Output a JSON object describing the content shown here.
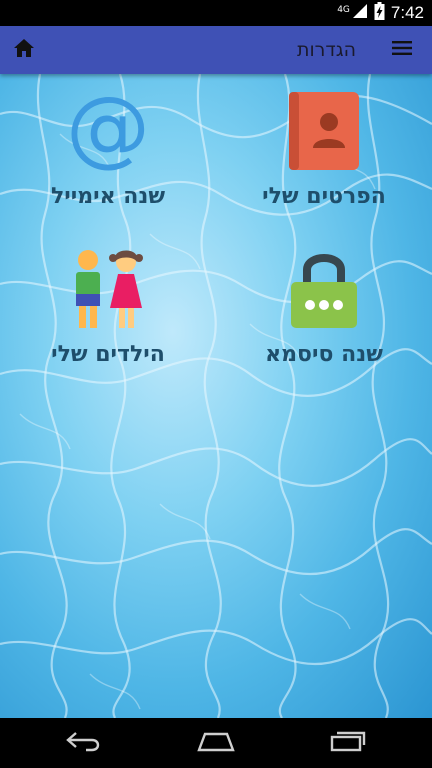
{
  "status_bar": {
    "network": "4G",
    "time": "7:42",
    "icons": [
      "signal-icon",
      "battery-charging-icon"
    ]
  },
  "app_bar": {
    "title": "הגדרות",
    "icons": [
      "home-icon",
      "menu-icon"
    ],
    "color": "#3f51b5"
  },
  "tiles": [
    {
      "id": "my-details",
      "label": "הפרטים שלי",
      "icon": "contacts-book-icon"
    },
    {
      "id": "change-email",
      "label": "שנה אימייל",
      "icon": "at-sign-icon"
    },
    {
      "id": "change-password",
      "label": "שנה סיסמא",
      "icon": "padlock-icon"
    },
    {
      "id": "my-children",
      "label": "הילדים שלי",
      "icon": "children-icon"
    }
  ],
  "at_symbol": "@",
  "nav_bar": {
    "icons": [
      "back-icon",
      "home-outline-icon",
      "recent-apps-icon"
    ]
  }
}
